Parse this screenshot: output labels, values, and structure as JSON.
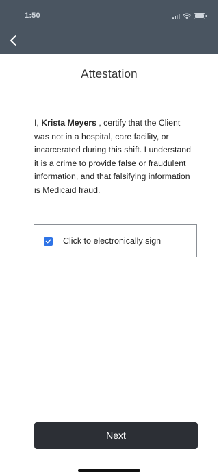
{
  "status_bar": {
    "time": "1:50",
    "icons": [
      "signal-icon",
      "wifi-icon",
      "battery-icon"
    ]
  },
  "nav": {
    "back_icon": "chevron-left-icon"
  },
  "page": {
    "title": "Attestation"
  },
  "attestation": {
    "prefix": "I, ",
    "name": "Krista Meyers",
    "body": " , certify that the Client was not in a hospital, care facility, or incarcerated during this shift. I understand it is a crime to provide false or fraudulent information, and that falsifying information is Medicaid fraud."
  },
  "signature": {
    "checked": true,
    "label": "Click to electronically sign"
  },
  "footer": {
    "next_label": "Next"
  },
  "colors": {
    "header_bg": "#4a5561",
    "checkbox_accent": "#2f74e6",
    "button_bg": "#2c2f35"
  }
}
